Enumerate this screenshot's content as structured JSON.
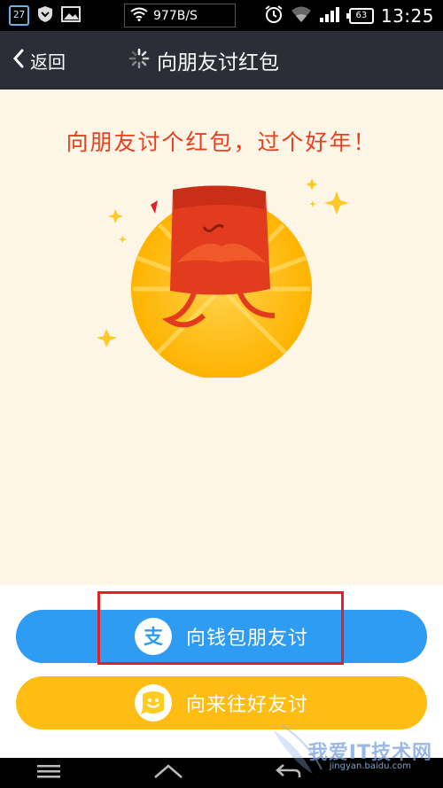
{
  "status_bar": {
    "calendar_day": "27",
    "net_speed": "977B/S",
    "battery": "63",
    "time": "13:25",
    "icons": [
      "calendar-icon",
      "shield-icon",
      "image-icon",
      "wifi-icon",
      "alarm-icon",
      "wifi-signal-icon",
      "cell-signal-icon",
      "battery-icon"
    ]
  },
  "header": {
    "back_label": "返回",
    "title": "向朋友讨红包"
  },
  "content": {
    "headline": "向朋友讨个红包，过个好年！",
    "colors": {
      "background": "#fdf6e6",
      "headline": "#e8401f",
      "sun": "#ffb400",
      "envelope": "#e03a1e"
    }
  },
  "buttons": {
    "wallet": {
      "label": "向钱包朋友讨",
      "icon": "alipay-icon",
      "color": "#2e9cf2"
    },
    "laiwang": {
      "label": "向来往好友讨",
      "icon": "laiwang-smile-icon",
      "color": "#ffbd14"
    }
  },
  "nav": {
    "icons": [
      "menu-icon",
      "home-icon",
      "back-icon"
    ]
  },
  "watermark": {
    "text": "我爱IT技术网",
    "sub": "jingyan.baidu.com"
  }
}
